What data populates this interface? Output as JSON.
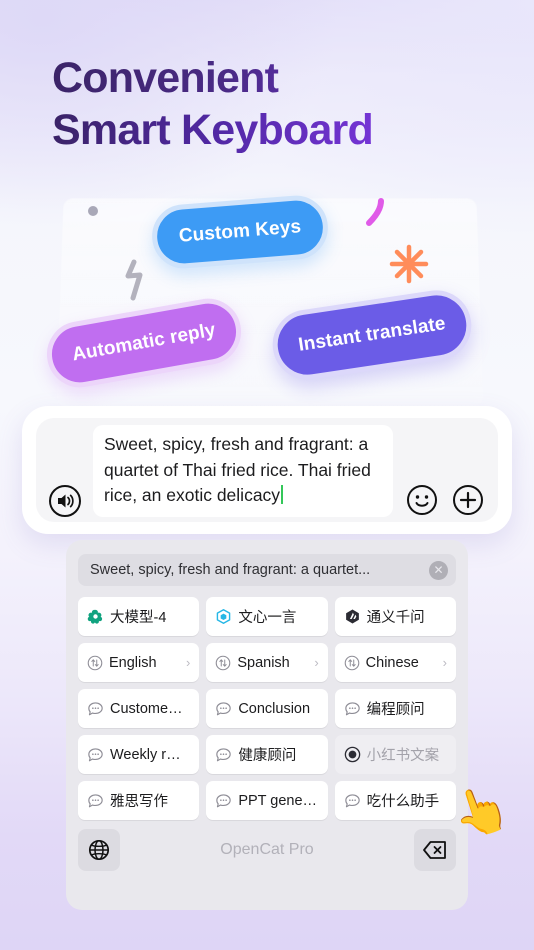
{
  "hero": {
    "line1": "Convenient",
    "line2": "Smart Keyboard"
  },
  "pills": [
    {
      "label": "Custom Keys",
      "color": "#3d9bf5",
      "name": "pill-custom-keys"
    },
    {
      "label": "Automatic reply",
      "color": "#c06ef0",
      "name": "pill-automatic-reply"
    },
    {
      "label": "Instant translate",
      "color": "#6b5ce7",
      "name": "pill-instant-translate"
    }
  ],
  "decor": {
    "dot_color": "#a9a8b8",
    "bolt_color": "#b3b2bd",
    "curve_color": "#e05ae8",
    "star_color": "#ff8c5a"
  },
  "input_card": {
    "text": "Sweet, spicy, fresh and fragrant: a quartet of Thai fried rice. Thai fried rice, an exotic delicacy",
    "caret_color": "#34c759",
    "speaker_icon": "speaker-icon",
    "emoji_icon": "smiley-icon",
    "plus_icon": "plus-icon"
  },
  "keyboard": {
    "suggestion": {
      "text": "Sweet, spicy, fresh and fragrant: a quartet...",
      "close_label": "✕"
    },
    "rows": [
      [
        {
          "label": "大模型-4",
          "icon": "openai-logo-icon",
          "icon_color": "#10a37f",
          "chevron": false,
          "pressed": false
        },
        {
          "label": "文心一言",
          "icon": "ernie-cube-icon",
          "icon_color": "#26b7e6",
          "chevron": false,
          "pressed": false
        },
        {
          "label": "通义千问",
          "icon": "tongyi-logo-icon",
          "icon_color": "#2b2b33",
          "chevron": false,
          "pressed": false
        }
      ],
      [
        {
          "label": "English",
          "icon": "translate-icon",
          "icon_color": "#8e8d96",
          "chevron": true,
          "pressed": false
        },
        {
          "label": "Spanish",
          "icon": "translate-icon",
          "icon_color": "#8e8d96",
          "chevron": true,
          "pressed": false
        },
        {
          "label": "Chinese",
          "icon": "translate-icon",
          "icon_color": "#8e8d96",
          "chevron": true,
          "pressed": false
        }
      ],
      [
        {
          "label": "Custome…",
          "icon": "chat-bubble-icon",
          "icon_color": "#8e8d96",
          "chevron": false,
          "pressed": false
        },
        {
          "label": "Conclusion",
          "icon": "chat-bubble-icon",
          "icon_color": "#8e8d96",
          "chevron": false,
          "pressed": false
        },
        {
          "label": "编程顾问",
          "icon": "chat-bubble-icon",
          "icon_color": "#8e8d96",
          "chevron": false,
          "pressed": false
        }
      ],
      [
        {
          "label": "Weekly r…",
          "icon": "chat-bubble-icon",
          "icon_color": "#8e8d96",
          "chevron": false,
          "pressed": false
        },
        {
          "label": "健康顾问",
          "icon": "chat-bubble-icon",
          "icon_color": "#8e8d96",
          "chevron": false,
          "pressed": false
        },
        {
          "label": "小红书文案",
          "icon": "radio-selected-icon",
          "icon_color": "#2b2b33",
          "chevron": false,
          "pressed": true
        }
      ],
      [
        {
          "label": "雅思写作",
          "icon": "chat-bubble-icon",
          "icon_color": "#8e8d96",
          "chevron": false,
          "pressed": false
        },
        {
          "label": "PPT gene…",
          "icon": "chat-bubble-icon",
          "icon_color": "#8e8d96",
          "chevron": false,
          "pressed": false
        },
        {
          "label": "吃什么助手",
          "icon": "chat-bubble-icon",
          "icon_color": "#8e8d96",
          "chevron": false,
          "pressed": false
        }
      ]
    ],
    "bottom": {
      "globe_icon": "globe-icon",
      "space_label": "OpenCat Pro",
      "backspace_icon": "backspace-icon"
    }
  },
  "pointer": {
    "emoji": "👆"
  }
}
